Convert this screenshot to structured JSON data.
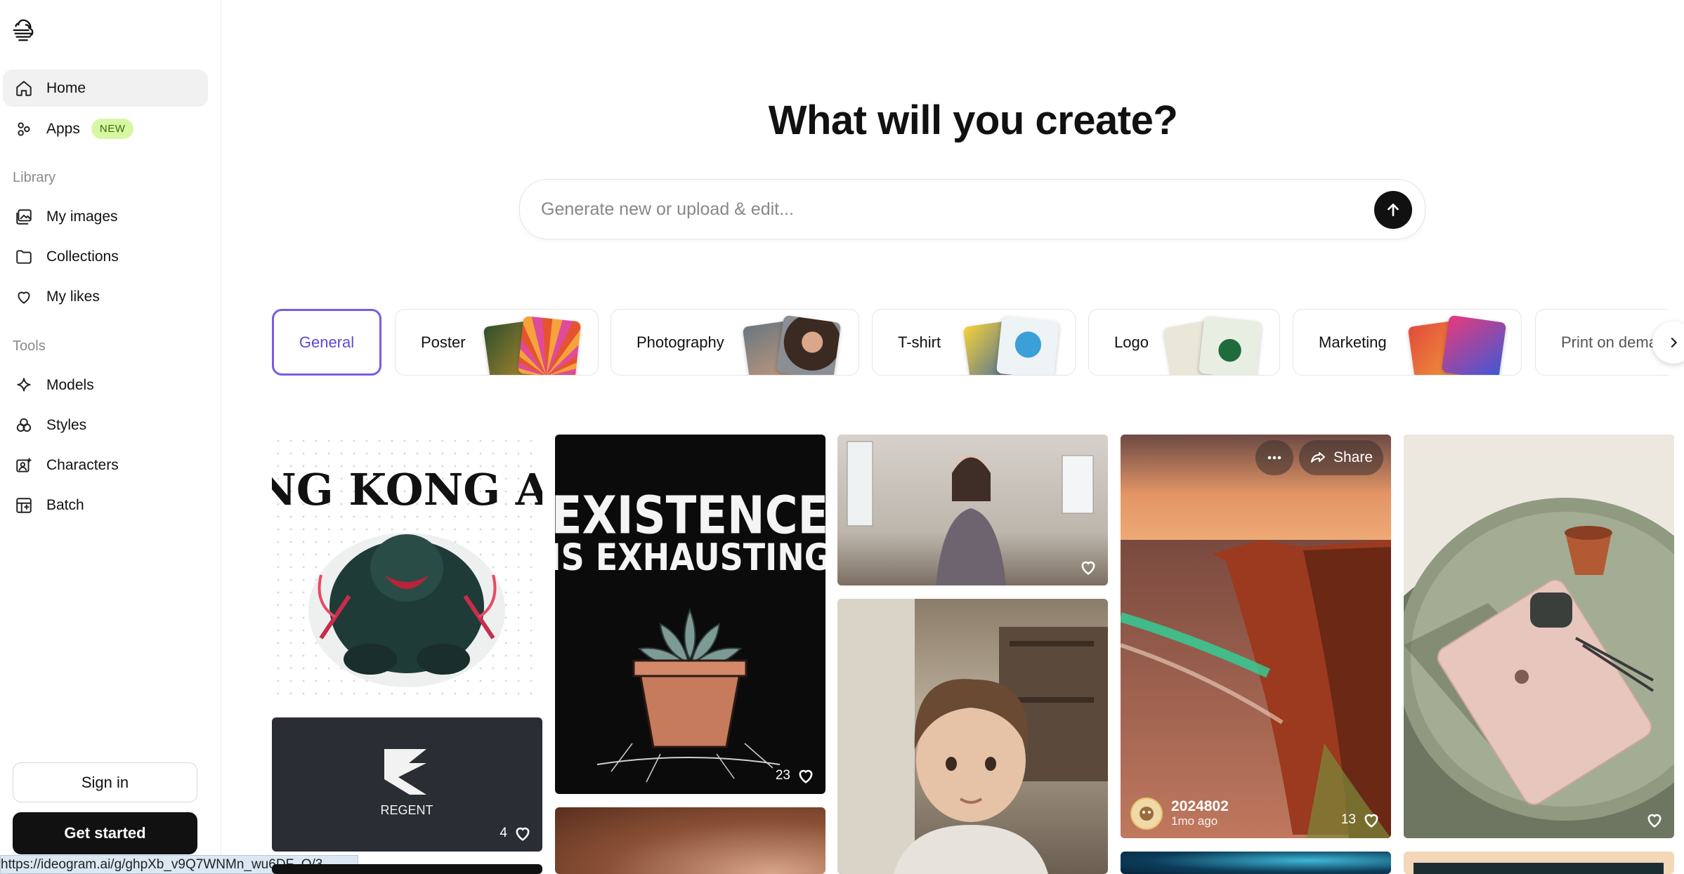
{
  "sidebar": {
    "nav": [
      {
        "label": "Home",
        "icon": "home-icon"
      },
      {
        "label": "Apps",
        "icon": "apps-icon",
        "badge": "NEW"
      }
    ],
    "library_label": "Library",
    "library": [
      {
        "label": "My images",
        "icon": "images-icon"
      },
      {
        "label": "Collections",
        "icon": "folder-icon"
      },
      {
        "label": "My likes",
        "icon": "heart-icon"
      }
    ],
    "tools_label": "Tools",
    "tools": [
      {
        "label": "Models",
        "icon": "sparkle-icon"
      },
      {
        "label": "Styles",
        "icon": "styles-icon"
      },
      {
        "label": "Characters",
        "icon": "character-icon"
      },
      {
        "label": "Batch",
        "icon": "batch-icon"
      }
    ],
    "sign_in": "Sign in",
    "get_started": "Get started"
  },
  "status_url": "https://ideogram.ai/g/ghpXb_v9Q7WNMn_wu6DF_Q/3",
  "main": {
    "headline": "What will you create?",
    "prompt_placeholder": "Generate new or upload & edit...",
    "categories": [
      {
        "label": "General",
        "selected": true
      },
      {
        "label": "Poster"
      },
      {
        "label": "Photography"
      },
      {
        "label": "T-shirt"
      },
      {
        "label": "Logo"
      },
      {
        "label": "Marketing"
      },
      {
        "label": "Print on dema"
      }
    ]
  },
  "gallery": {
    "poster_kingkong_text": "KING KONG APE",
    "regent_text": "REGENT",
    "regent_likes": "4",
    "existence_line1": "EXISTENCE",
    "existence_line2": "IS EXHAUSTING",
    "existence_likes": "23",
    "coast_author": "2024802",
    "coast_time": "1mo ago",
    "coast_likes": "13",
    "share_label": "Share"
  },
  "colors": {
    "accent_purple": "#7b5be0",
    "badge_green": "#d8f7a3",
    "button_dark": "#111111"
  }
}
